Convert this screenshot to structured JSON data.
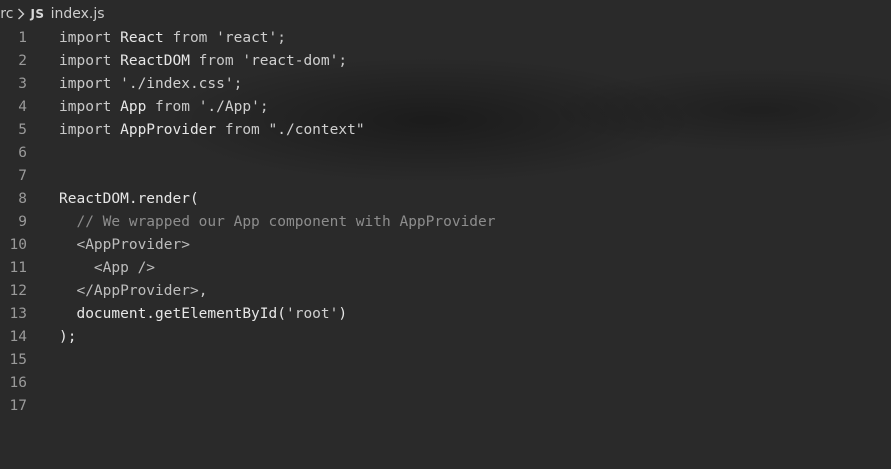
{
  "breadcrumb": {
    "folder": "src",
    "file_icon": "JS",
    "file": "index.js"
  },
  "icons": {
    "separator": "chevron-right-icon",
    "file": "javascript-file-icon"
  },
  "code": {
    "lines": [
      {
        "n": "1",
        "tokens": [
          {
            "t": "import ",
            "k": "kw"
          },
          {
            "t": "React",
            "k": "id"
          },
          {
            "t": " from ",
            "k": "kw"
          },
          {
            "t": "'react'",
            "k": "str"
          },
          {
            "t": ";",
            "k": "kw"
          }
        ]
      },
      {
        "n": "2",
        "tokens": [
          {
            "t": "import ",
            "k": "kw"
          },
          {
            "t": "ReactDOM",
            "k": "id"
          },
          {
            "t": " from ",
            "k": "kw"
          },
          {
            "t": "'react-dom'",
            "k": "str"
          },
          {
            "t": ";",
            "k": "kw"
          }
        ]
      },
      {
        "n": "3",
        "tokens": [
          {
            "t": "import ",
            "k": "kw"
          },
          {
            "t": "'./index.css'",
            "k": "str"
          },
          {
            "t": ";",
            "k": "kw"
          }
        ]
      },
      {
        "n": "4",
        "tokens": [
          {
            "t": "import ",
            "k": "kw"
          },
          {
            "t": "App",
            "k": "id"
          },
          {
            "t": " from ",
            "k": "kw"
          },
          {
            "t": "'./App'",
            "k": "str"
          },
          {
            "t": ";",
            "k": "kw"
          }
        ]
      },
      {
        "n": "5",
        "tokens": [
          {
            "t": "import ",
            "k": "kw"
          },
          {
            "t": "AppProvider",
            "k": "id"
          },
          {
            "t": " from ",
            "k": "kw"
          },
          {
            "t": "\"./context\"",
            "k": "str"
          }
        ]
      },
      {
        "n": "6",
        "tokens": []
      },
      {
        "n": "7",
        "tokens": []
      },
      {
        "n": "8",
        "tokens": [
          {
            "t": "ReactDOM",
            "k": "id"
          },
          {
            "t": ".render(",
            "k": "id"
          }
        ]
      },
      {
        "n": "9",
        "tokens": [
          {
            "t": "  // We wrapped our App component with AppProvider",
            "k": "cmt"
          }
        ]
      },
      {
        "n": "10",
        "tokens": [
          {
            "t": "  <AppProvider>",
            "k": "tag"
          }
        ]
      },
      {
        "n": "11",
        "tokens": [
          {
            "t": "    <App />",
            "k": "tag"
          }
        ]
      },
      {
        "n": "12",
        "tokens": [
          {
            "t": "  </AppProvider>",
            "k": "tag"
          },
          {
            "t": ",",
            "k": "kw"
          }
        ]
      },
      {
        "n": "13",
        "tokens": [
          {
            "t": "  document.getElementById(",
            "k": "id"
          },
          {
            "t": "'root'",
            "k": "str"
          },
          {
            "t": ")",
            "k": "id"
          }
        ]
      },
      {
        "n": "14",
        "tokens": [
          {
            "t": ");",
            "k": "id"
          }
        ]
      },
      {
        "n": "15",
        "tokens": []
      },
      {
        "n": "16",
        "tokens": []
      },
      {
        "n": "17",
        "tokens": []
      }
    ]
  }
}
